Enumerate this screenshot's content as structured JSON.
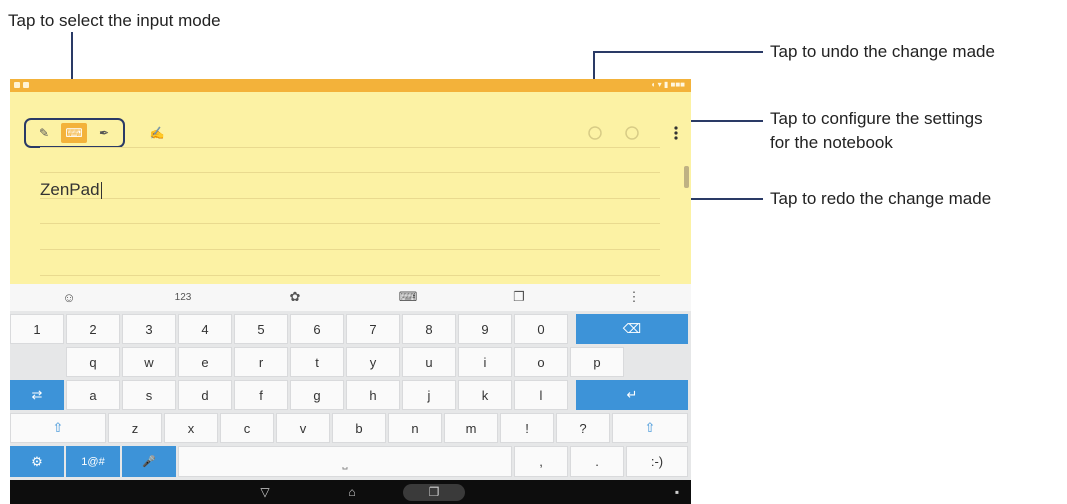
{
  "callouts": {
    "input_mode": "Tap to select the input mode",
    "undo": "Tap to undo the change made",
    "settings_line1": "Tap to configure the settings",
    "settings_line2": "for the notebook",
    "redo": "Tap to redo the change made"
  },
  "colors": {
    "accent": "#f3b23a",
    "note_bg": "#fcf2a4",
    "key_blue": "#3d93d8",
    "callout_line": "#2a3a66"
  },
  "note": {
    "text": "ZenPad"
  },
  "toolbar": {
    "mode_buttons": [
      {
        "icon": "handwriting-icon",
        "glyph": "✎"
      },
      {
        "icon": "keyboard-icon",
        "glyph": "⌨"
      },
      {
        "icon": "brush-icon",
        "glyph": "✒"
      }
    ],
    "pen_icon": "edit-pen-icon",
    "undo_icon": "undo-icon",
    "redo_icon": "redo-icon",
    "menu_icon": "more-options-icon"
  },
  "keyboard": {
    "suggestion_bar": [
      {
        "name": "emoji-icon",
        "label": "☺"
      },
      {
        "name": "numbers-button",
        "label": "123"
      },
      {
        "name": "theme-icon",
        "label": "✿"
      },
      {
        "name": "keyboard-layout-icon",
        "label": "⌨"
      },
      {
        "name": "clipboard-icon",
        "label": "❐"
      },
      {
        "name": "more-icon",
        "label": "⋮"
      }
    ],
    "row1": [
      "1",
      "2",
      "3",
      "4",
      "5",
      "6",
      "7",
      "8",
      "9",
      "0"
    ],
    "row1_backspace": "⌫",
    "row2": [
      "q",
      "w",
      "e",
      "r",
      "t",
      "y",
      "u",
      "i",
      "o",
      "p"
    ],
    "row3_tab": "⇄",
    "row3": [
      "a",
      "s",
      "d",
      "f",
      "g",
      "h",
      "j",
      "k",
      "l"
    ],
    "row3_enter": "↵",
    "row4_shift": "⇧",
    "row4": [
      "z",
      "x",
      "c",
      "v",
      "b",
      "n",
      "m",
      "!",
      "?"
    ],
    "row4_shift_right": "⇧",
    "row5": {
      "settings": "⚙",
      "symbols": "1@#",
      "mic": "🎤",
      "space": "⎵",
      "comma": ",",
      "period": ".",
      "emoticon": ":-)"
    }
  },
  "navbar": {
    "back": "▽",
    "home": "⌂",
    "recents": "❐"
  }
}
